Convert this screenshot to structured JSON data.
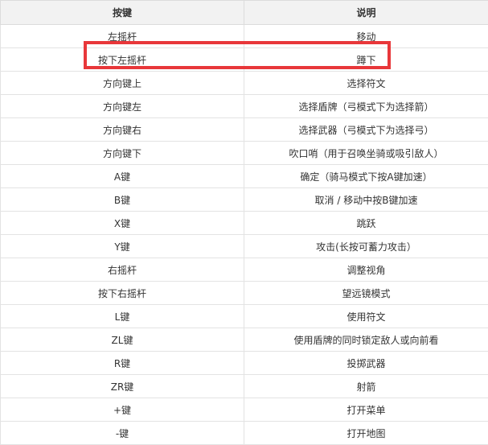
{
  "table": {
    "headers": [
      "按键",
      "说明"
    ],
    "rows": [
      {
        "key": "左摇杆",
        "desc": "移动"
      },
      {
        "key": "按下左摇杆",
        "desc": "蹲下"
      },
      {
        "key": "方向键上",
        "desc": "选择符文"
      },
      {
        "key": "方向键左",
        "desc": "选择盾牌（弓模式下为选择箭）"
      },
      {
        "key": "方向键右",
        "desc": "选择武器（弓模式下为选择弓）"
      },
      {
        "key": "方向键下",
        "desc": "吹口哨（用于召唤坐骑或吸引敌人）"
      },
      {
        "key": "A键",
        "desc": "确定（骑马模式下按A键加速）"
      },
      {
        "key": "B键",
        "desc": "取消 / 移动中按B键加速"
      },
      {
        "key": "X键",
        "desc": "跳跃"
      },
      {
        "key": "Y键",
        "desc": "攻击(长按可蓄力攻击）"
      },
      {
        "key": "右摇杆",
        "desc": "调整视角"
      },
      {
        "key": "按下右摇杆",
        "desc": "望远镜模式"
      },
      {
        "key": "L键",
        "desc": "使用符文"
      },
      {
        "key": "ZL键",
        "desc": "使用盾牌的同时锁定敌人或向前看"
      },
      {
        "key": "R键",
        "desc": "投掷武器"
      },
      {
        "key": "ZR键",
        "desc": "射箭"
      },
      {
        "key": "+键",
        "desc": "打开菜单"
      },
      {
        "key": "-键",
        "desc": "打开地图"
      }
    ]
  },
  "colors": {
    "highlight": "#e8373a",
    "header_bg": "#f2f2f2",
    "border": "#e3e3e3"
  }
}
